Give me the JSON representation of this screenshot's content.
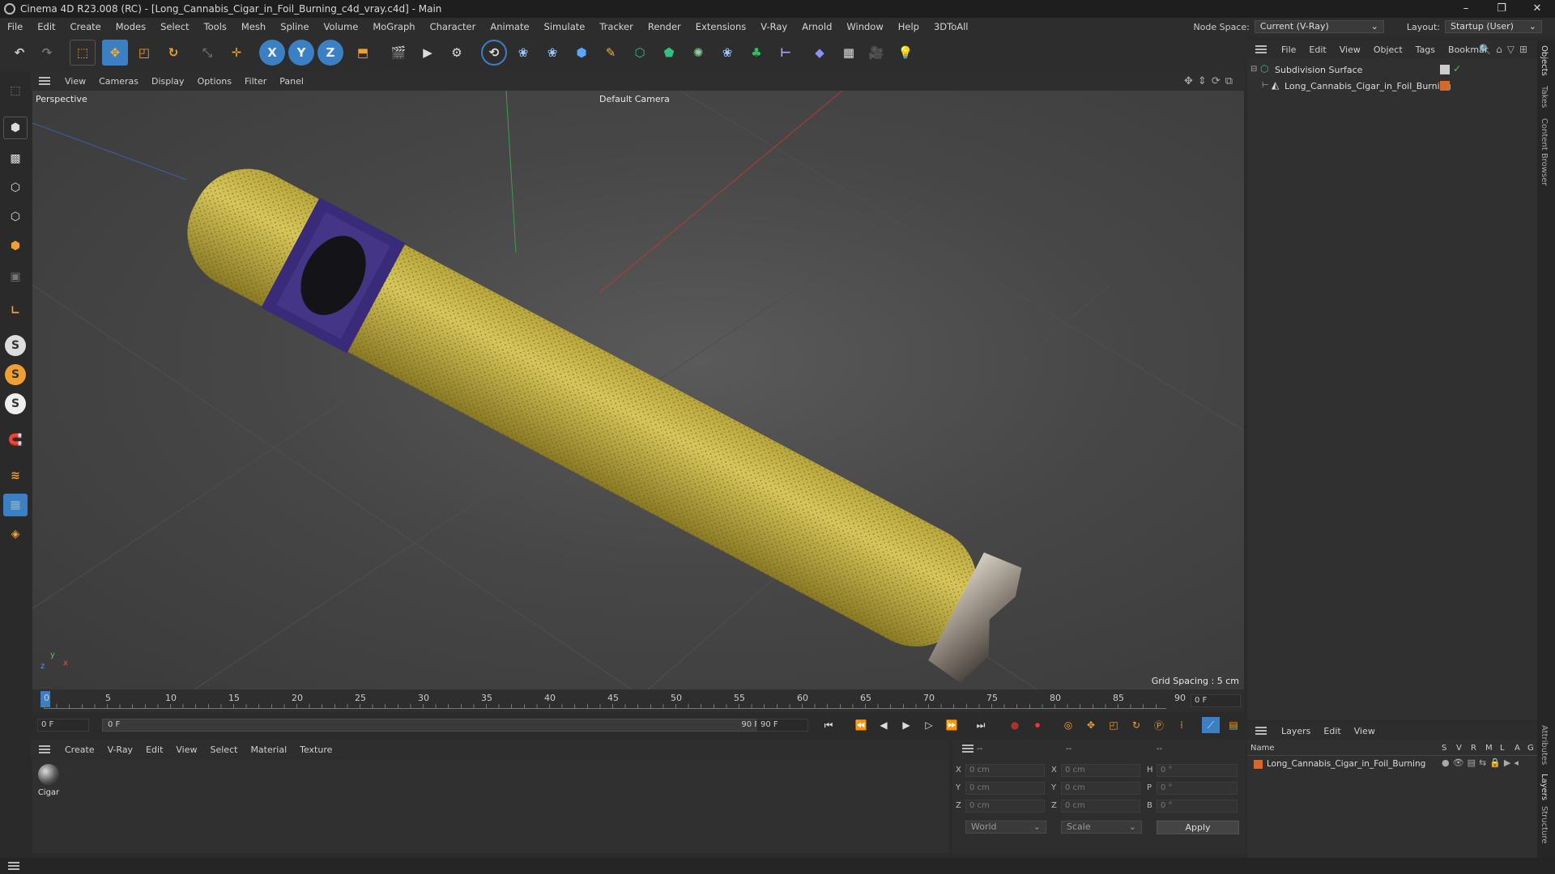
{
  "window": {
    "title": "Cinema 4D R23.008 (RC) - [Long_Cannabis_Cigar_in_Foil_Burning_c4d_vray.c4d] - Main",
    "controls": [
      "–",
      "❐",
      "✕"
    ]
  },
  "menubar": {
    "items": [
      "File",
      "Edit",
      "Create",
      "Modes",
      "Select",
      "Tools",
      "Mesh",
      "Spline",
      "Volume",
      "MoGraph",
      "Character",
      "Animate",
      "Simulate",
      "Tracker",
      "Render",
      "Extensions",
      "V-Ray",
      "Arnold",
      "Window",
      "Help",
      "3DToAll"
    ],
    "node_space_label": "Node Space:",
    "node_space_value": "Current (V-Ray)",
    "layout_label": "Layout:",
    "layout_value": "Startup (User)"
  },
  "toolbar": {
    "axis_x": "X",
    "axis_y": "Y",
    "axis_z": "Z"
  },
  "viewport": {
    "menu": [
      "View",
      "Cameras",
      "Display",
      "Options",
      "Filter",
      "Panel"
    ],
    "label": "Perspective",
    "camera": "Default Camera",
    "grid_spacing": "Grid Spacing : 5 cm",
    "axis_labels": {
      "y": "y",
      "z": "z",
      "x": "x"
    }
  },
  "timeline": {
    "ticks": [
      "0",
      "5",
      "10",
      "15",
      "20",
      "25",
      "30",
      "35",
      "40",
      "45",
      "50",
      "55",
      "60",
      "65",
      "70",
      "75",
      "80",
      "85",
      "90"
    ],
    "current_frame_field": "0 F"
  },
  "transport": {
    "start_field": "0 F",
    "range_start": "0 F",
    "range_end": "90 F",
    "end_field": "90 F"
  },
  "materials": {
    "menu": [
      "Create",
      "V-Ray",
      "Edit",
      "View",
      "Select",
      "Material",
      "Texture"
    ],
    "items": [
      {
        "name": "Cigar"
      }
    ]
  },
  "coordinates": {
    "header_left": "--",
    "header_mid": "--",
    "header_right": "--",
    "rows": [
      {
        "axis": "X",
        "pos": "0 cm",
        "size_axis": "X",
        "size": "0 cm",
        "rot_axis": "H",
        "rot": "0 °"
      },
      {
        "axis": "Y",
        "pos": "0 cm",
        "size_axis": "Y",
        "size": "0 cm",
        "rot_axis": "P",
        "rot": "0 °"
      },
      {
        "axis": "Z",
        "pos": "0 cm",
        "size_axis": "Z",
        "size": "0 cm",
        "rot_axis": "B",
        "rot": "0 °"
      }
    ],
    "space": "World",
    "mode": "Scale",
    "apply": "Apply"
  },
  "objects": {
    "menu": [
      "File",
      "Edit",
      "View",
      "Object",
      "Tags",
      "Bookmar"
    ],
    "tree": [
      {
        "name": "Subdivision Surface",
        "level": 0
      },
      {
        "name": "Long_Cannabis_Cigar_in_Foil_Burning",
        "level": 1
      }
    ]
  },
  "layers": {
    "menu": [
      "Layers",
      "Edit",
      "View"
    ],
    "columns": [
      "Name",
      "S",
      "V",
      "R",
      "M",
      "L",
      "A",
      "G"
    ],
    "rows": [
      {
        "name": "Long_Cannabis_Cigar_in_Foil_Burning",
        "color": "#d9662a"
      }
    ]
  },
  "side_tabs": [
    "Objects",
    "Takes",
    "Content Browser",
    "Attributes",
    "Layers",
    "Structure"
  ],
  "colors": {
    "accent": "#3b7fc4",
    "cigar": "#c8b748",
    "layer_orange": "#d9662a"
  }
}
